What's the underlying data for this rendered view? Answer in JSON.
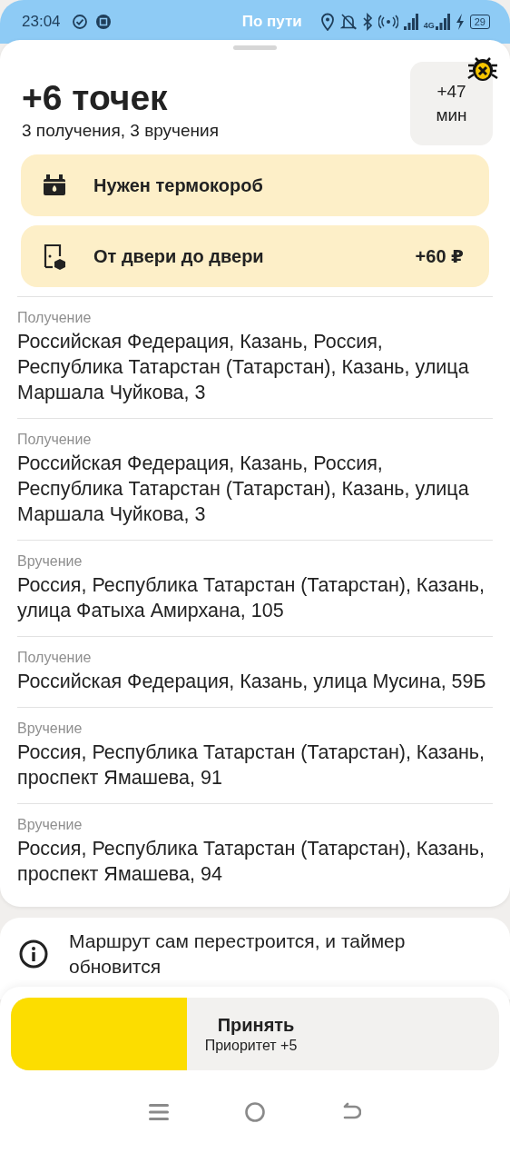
{
  "status_bar": {
    "time": "23:04",
    "title": "По пути",
    "network": "4G",
    "battery": "29"
  },
  "order": {
    "title": "+6 точек",
    "subtitle": "3 получения, 3 вручения",
    "time_badge": {
      "value": "+47",
      "unit": "мин"
    }
  },
  "requirements": [
    {
      "kind": "thermobox",
      "label": "Нужен термокороб"
    },
    {
      "kind": "door",
      "label": "От двери до двери",
      "bonus": "+60 ₽"
    }
  ],
  "points": [
    {
      "type": "Получение",
      "address": "Российская Федерация, Казань, Россия, Республика Татарстан (Татарстан), Казань, улица Маршала Чуйкова, 3"
    },
    {
      "type": "Получение",
      "address": "Российская Федерация, Казань, Россия, Республика Татарстан (Татарстан), Казань, улица Маршала Чуйкова, 3"
    },
    {
      "type": "Вручение",
      "address": "Россия, Республика Татарстан (Татарстан), Казань, улица Фатыха Амирхана, 105"
    },
    {
      "type": "Получение",
      "address": "Российская Федерация, Казань, улица Мусина, 59Б"
    },
    {
      "type": "Вручение",
      "address": "Россия, Республика Татарстан (Татарстан), Казань, проспект Ямашева, 91"
    },
    {
      "type": "Вручение",
      "address": "Россия, Республика Татарстан (Татарстан), Казань, проспект Ямашева, 94"
    }
  ],
  "info": {
    "text": "Маршрут сам перестроится, и таймер обновится"
  },
  "accept": {
    "label": "Принять",
    "sublabel": "Приоритет +5",
    "level": 0.36
  }
}
